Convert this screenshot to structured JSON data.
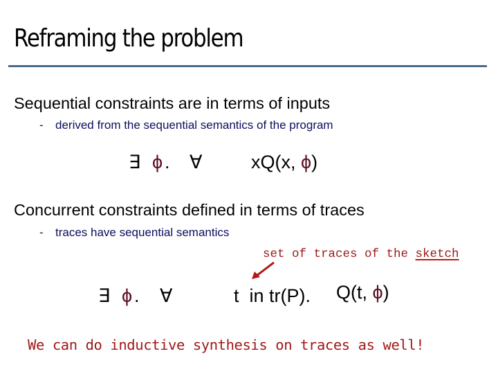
{
  "slide": {
    "title": "Reframing the problem",
    "accent_color": "#4a6a8a",
    "sections": [
      {
        "heading": "Sequential constraints are in terms of inputs",
        "sub_bullet": {
          "marker": "-",
          "text": "derived from the sequential semantics of the program"
        },
        "formula": {
          "exists": "∃",
          "phi": "ϕ",
          "dot": ".",
          "forall": "∀",
          "body_prefix": "xQ(x, ",
          "body_phi": "ϕ",
          "body_suffix": ")"
        }
      },
      {
        "heading": "Concurrent constraints defined in terms of traces",
        "sub_bullet": {
          "marker": "-",
          "text": "traces have sequential semantics"
        },
        "annotation": {
          "prefix": "set of traces of the ",
          "underlined": "sketch",
          "arrow": "arrow-down-left"
        },
        "formula": {
          "exists": "∃",
          "phi": "ϕ",
          "dot": ".",
          "forall": "∀",
          "domain": "t  in tr(P).",
          "body_prefix": "Q(t, ",
          "body_phi": "ϕ",
          "body_suffix": ")"
        }
      }
    ],
    "conclusion": "We can do inductive synthesis on traces as well!"
  }
}
